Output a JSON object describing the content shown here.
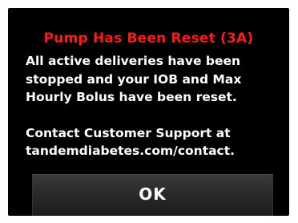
{
  "dialog": {
    "title": "Pump Has Been Reset (3A)",
    "message_lines": [
      "All active deliveries have been",
      "stopped and your IOB and Max",
      "Hourly Bolus have been reset."
    ],
    "contact_lines": [
      "Contact Customer Support at",
      "tandemdiabetes.com/contact."
    ],
    "ok_label": "OK"
  },
  "colors": {
    "title": "#ff1a1a",
    "text": "#ffffff",
    "background": "#000000",
    "button": "#2a2a2a"
  }
}
